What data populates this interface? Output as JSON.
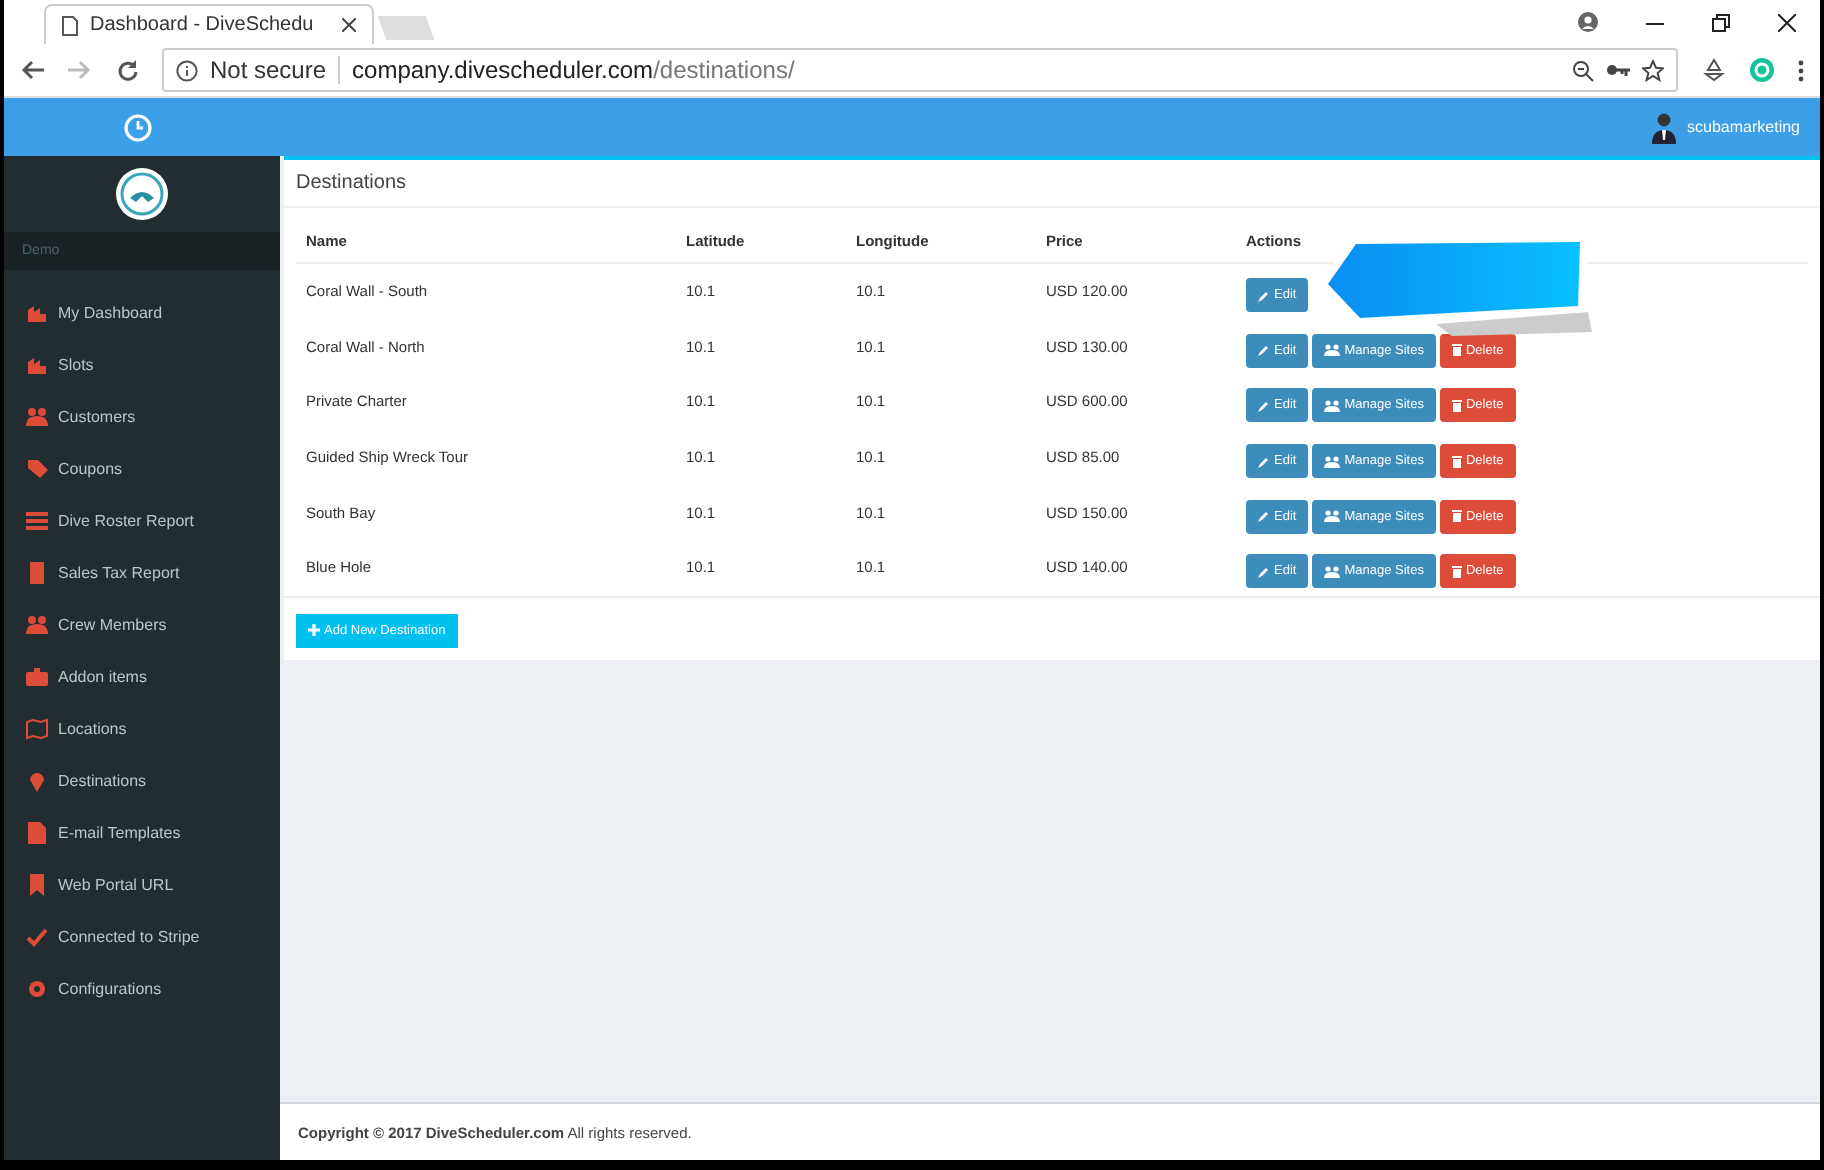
{
  "browser": {
    "tab_title": "Dashboard - DiveSchedu",
    "security": "Not secure",
    "url_host": "company.divescheduler.com",
    "url_path": "/destinations/"
  },
  "header": {
    "username": "scubamarketing"
  },
  "sidebar": {
    "section": "Demo",
    "items": [
      {
        "label": "My Dashboard",
        "selected": false
      },
      {
        "label": "Slots",
        "selected": false
      },
      {
        "label": "Customers",
        "selected": false
      },
      {
        "label": "Coupons",
        "selected": false
      },
      {
        "label": "Dive Roster Report",
        "selected": false
      },
      {
        "label": "Sales Tax Report",
        "selected": false
      },
      {
        "label": "Crew Members",
        "selected": false
      },
      {
        "label": "Addon items",
        "selected": false
      },
      {
        "label": "Locations",
        "selected": false
      },
      {
        "label": "Destinations",
        "selected": false
      },
      {
        "label": "E-mail Templates",
        "selected": false
      },
      {
        "label": "Web Portal URL",
        "selected": false
      },
      {
        "label": "Connected to Stripe",
        "selected": false
      },
      {
        "label": "Configurations",
        "selected": false
      }
    ]
  },
  "panel": {
    "title": "Destinations",
    "table": {
      "columns": [
        "Name",
        "Latitude",
        "Longitude",
        "Price",
        "Actions"
      ],
      "rows": [
        {
          "cells": [
            "Coral Wall - South",
            "10.1",
            "10.1",
            "USD 120.00"
          ],
          "actions": [
            {
              "kind": "edit",
              "label": "Edit"
            }
          ]
        },
        {
          "cells": [
            "Coral Wall - North",
            "10.1",
            "10.1",
            "USD 130.00"
          ],
          "actions": [
            {
              "kind": "edit",
              "label": "Edit"
            },
            {
              "kind": "manage",
              "label": "Manage Sites"
            },
            {
              "kind": "delete",
              "label": "Delete"
            }
          ]
        },
        {
          "cells": [
            "Private Charter",
            "10.1",
            "10.1",
            "USD 600.00"
          ],
          "actions": [
            {
              "kind": "edit",
              "label": "Edit"
            },
            {
              "kind": "manage",
              "label": "Manage Sites"
            },
            {
              "kind": "delete",
              "label": "Delete"
            }
          ]
        },
        {
          "cells": [
            "Guided Ship Wreck Tour",
            "10.1",
            "10.1",
            "USD 85.00"
          ],
          "actions": [
            {
              "kind": "edit",
              "label": "Edit"
            },
            {
              "kind": "manage",
              "label": "Manage Sites"
            },
            {
              "kind": "delete",
              "label": "Delete"
            }
          ]
        },
        {
          "cells": [
            "South Bay",
            "10.1",
            "10.1",
            "USD 150.00"
          ],
          "actions": [
            {
              "kind": "edit",
              "label": "Edit"
            },
            {
              "kind": "manage",
              "label": "Manage Sites"
            },
            {
              "kind": "delete",
              "label": "Delete"
            }
          ]
        },
        {
          "cells": [
            "Blue Hole",
            "10.1",
            "10.1",
            "USD 140.00"
          ],
          "actions": [
            {
              "kind": "edit",
              "label": "Edit"
            },
            {
              "kind": "manage",
              "label": "Manage Sites"
            },
            {
              "kind": "delete",
              "label": "Delete"
            }
          ]
        }
      ]
    },
    "add_button": "Add New Destination"
  },
  "footer": {
    "copyright": "**Copyright © 2017 DiveScheduler.com** All rights reserved."
  }
}
